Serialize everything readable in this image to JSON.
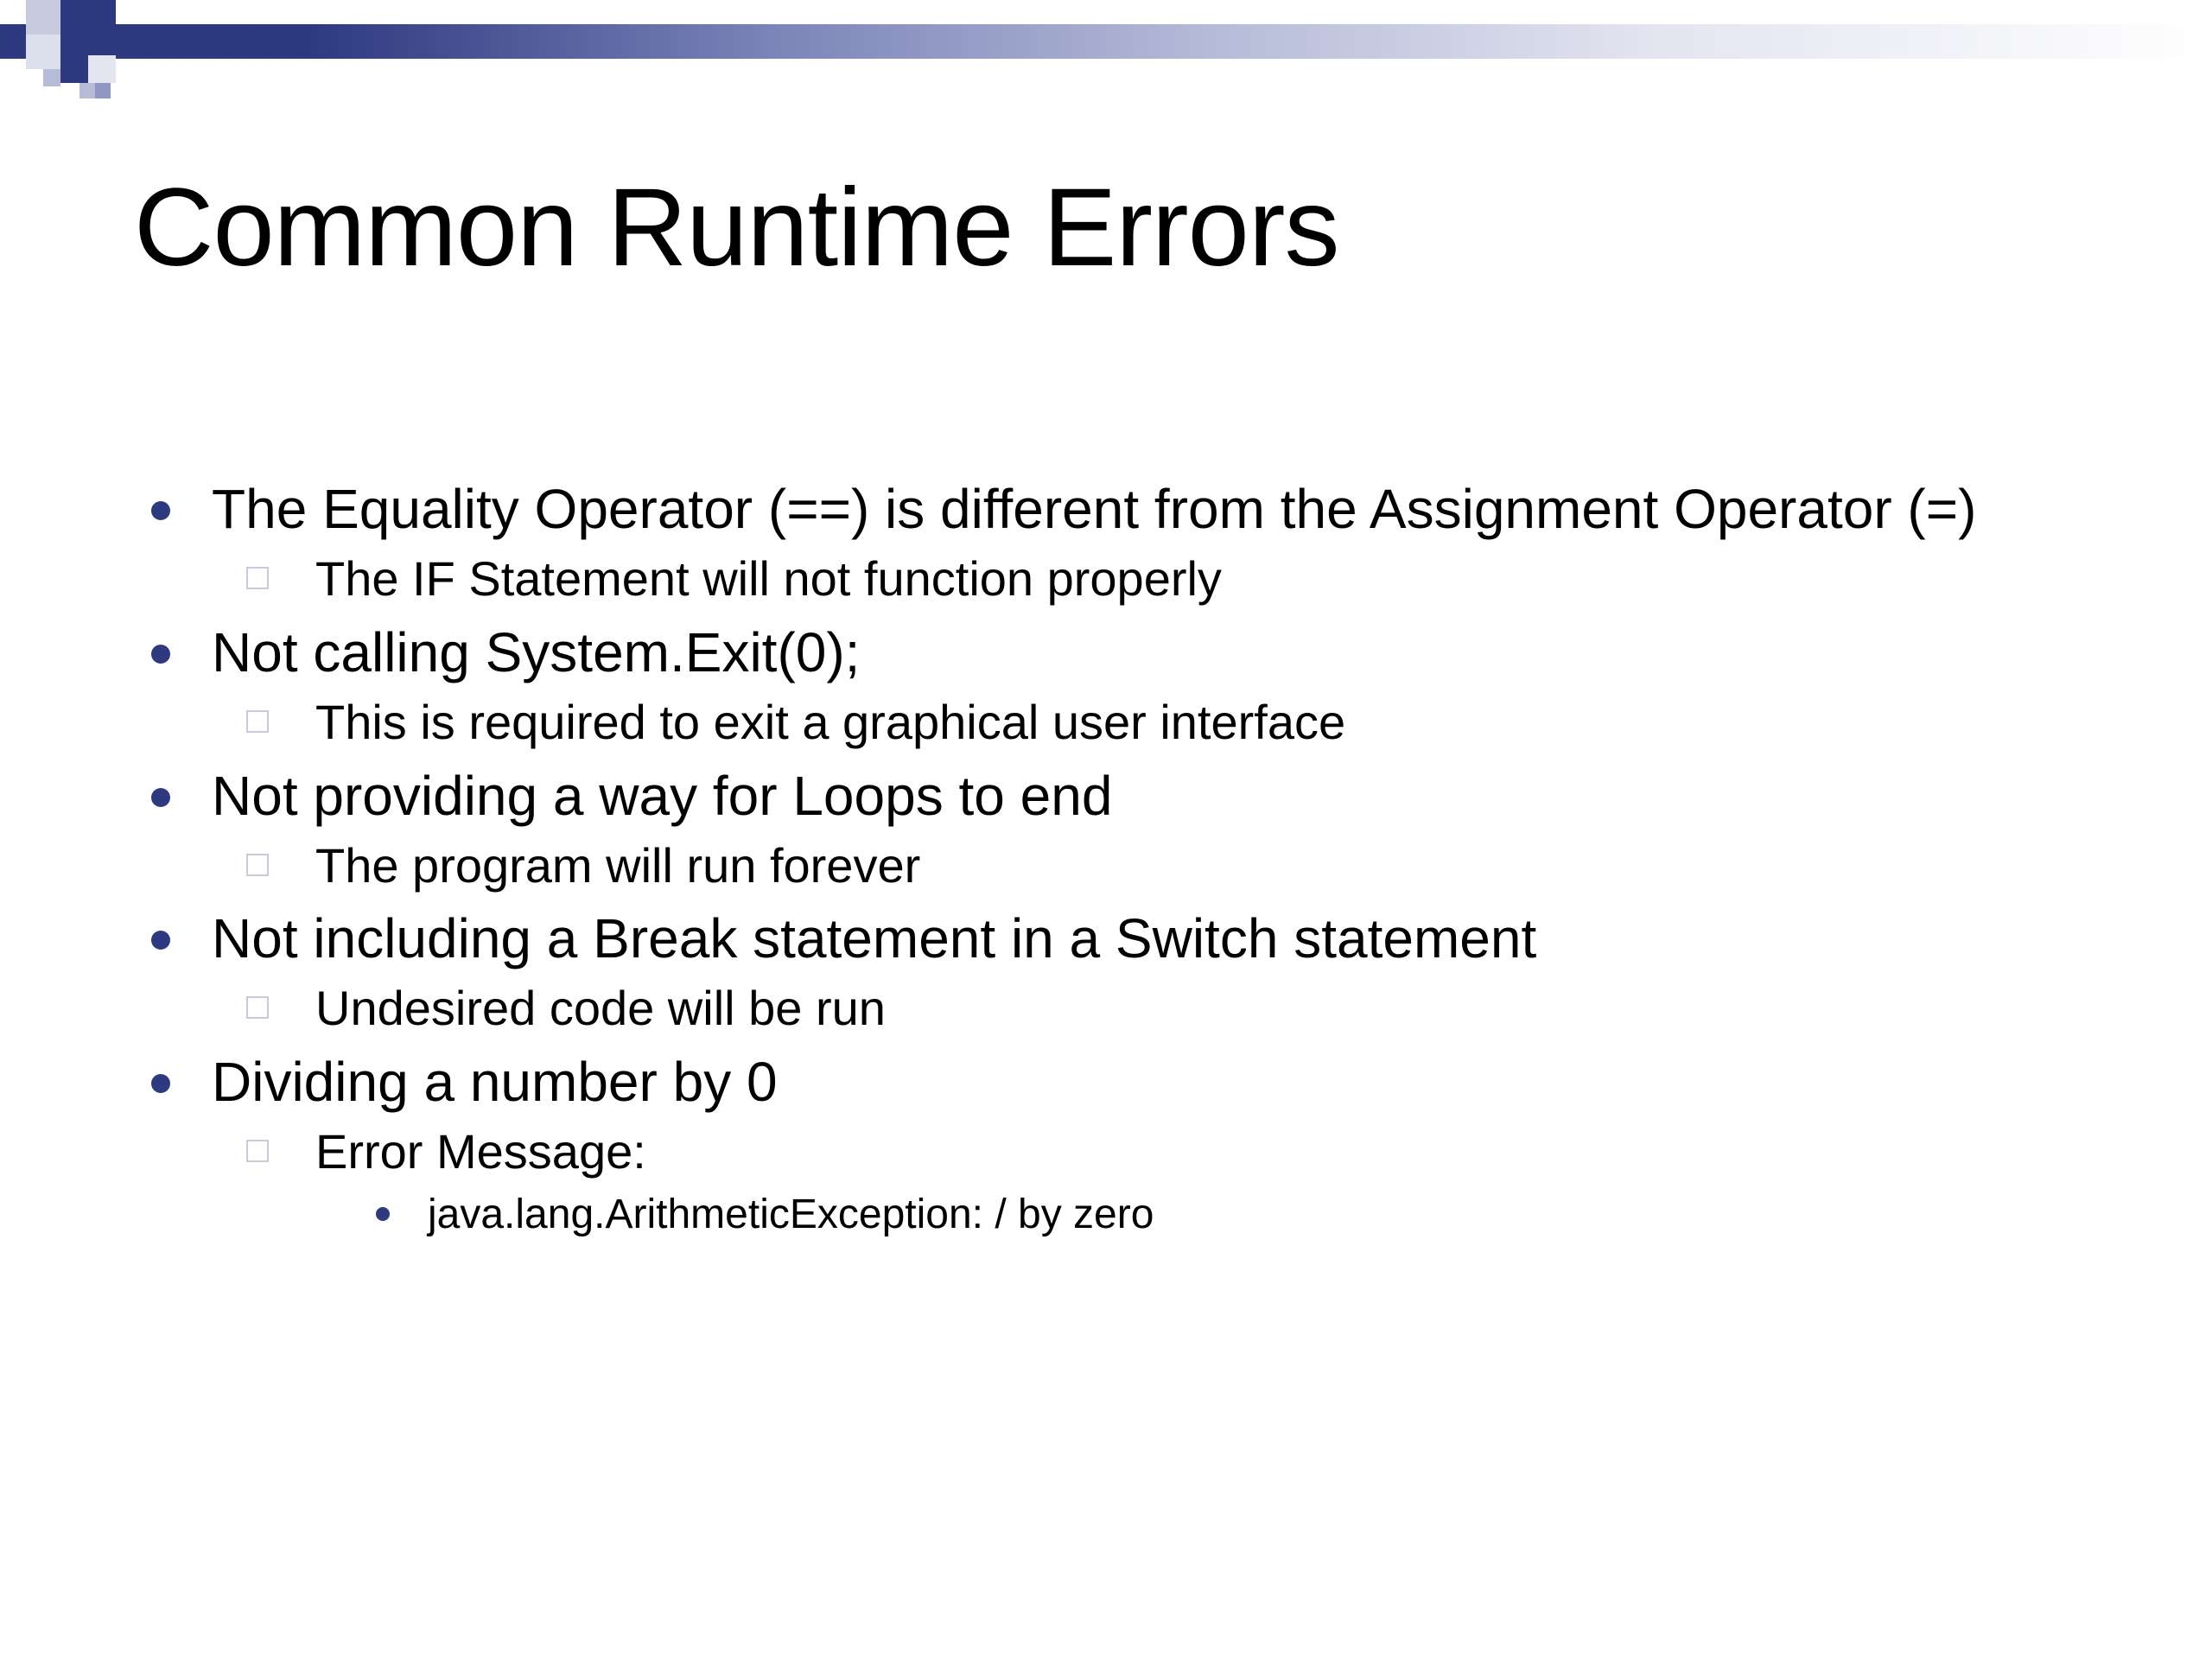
{
  "title": "Common Runtime Errors",
  "bullets": [
    {
      "text": "The Equality Operator (==) is different from the Assignment Operator (=)",
      "sub": [
        {
          "text": "The IF Statement will not function properly"
        }
      ]
    },
    {
      "text": "Not calling System.Exit(0);",
      "sub": [
        {
          "text": "This is required to exit a graphical user interface"
        }
      ]
    },
    {
      "text": "Not providing a way for Loops to end",
      "sub": [
        {
          "text": "The program will run forever"
        }
      ]
    },
    {
      "text": "Not including a Break statement in a Switch statement",
      "sub": [
        {
          "text": "Undesired code will be run"
        }
      ]
    },
    {
      "text": "Dividing a number by 0",
      "sub": [
        {
          "text": "Error Message:",
          "sub": [
            {
              "text": "java.lang.ArithmeticException: / by zero"
            }
          ]
        }
      ]
    }
  ]
}
